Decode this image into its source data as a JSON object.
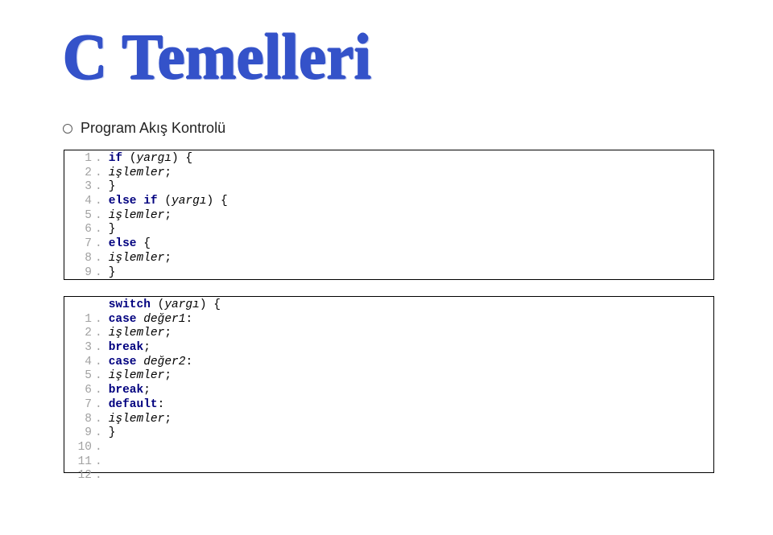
{
  "title": "C Temelleri",
  "subtitle": "Program Akış Kontrolü",
  "box1": {
    "rows": [
      {
        "num": "1",
        "html": "<span class='kw'>if</span> (<span class='ital'>yargı</span>) {"
      },
      {
        "num": "2",
        "html": "<span class='ital'>işlemler</span>;"
      },
      {
        "num": "3",
        "html": "}"
      },
      {
        "num": "4",
        "html": "<span class='kw'>else if</span> (<span class='ital'>yargı</span>) {"
      },
      {
        "num": "5",
        "html": "<span class='ital'>işlemler</span>;"
      },
      {
        "num": "6",
        "html": "}"
      },
      {
        "num": "7",
        "html": "<span class='kw'>else</span> {"
      },
      {
        "num": "8",
        "html": "<span class='ital'>işlemler</span>;"
      },
      {
        "num": "9",
        "html": "}"
      }
    ]
  },
  "box2": {
    "headerHtml": "<span class='kw'>switch</span> (<span class='ital'>yargı</span>) {",
    "rows": [
      {
        "num": "1",
        "html": "<span class='kw'>case</span> <span class='ital'>değer1</span>:"
      },
      {
        "num": "2",
        "html": "<span class='ital'>işlemler</span>;"
      },
      {
        "num": "3",
        "html": "<span class='kw'>break</span>;"
      },
      {
        "num": "4",
        "html": "<span class='kw'>case</span> <span class='ital'>değer2</span>:"
      },
      {
        "num": "5",
        "html": "<span class='ital'>işlemler</span>;"
      },
      {
        "num": "6",
        "html": "<span class='kw'>break</span>;"
      },
      {
        "num": "7",
        "html": "<span class='kw'>default</span>:"
      },
      {
        "num": "8",
        "html": "<span class='ital'>işlemler</span>;"
      },
      {
        "num": "9",
        "html": "}"
      },
      {
        "num": "10",
        "html": ""
      },
      {
        "num": "11",
        "html": ""
      },
      {
        "num": "12",
        "html": ""
      }
    ]
  },
  "sep": "."
}
